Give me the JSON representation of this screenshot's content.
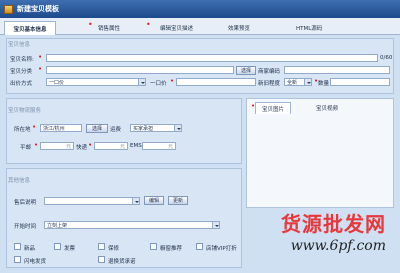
{
  "window": {
    "title": "新建宝贝模板"
  },
  "tabs": [
    {
      "label": "宝贝基本信息"
    },
    {
      "label": "销售属性"
    },
    {
      "label": "编辑宝贝描述"
    },
    {
      "label": "效果预览"
    },
    {
      "label": "HTML源码"
    }
  ],
  "basic": {
    "header": "宝贝信息",
    "name_label": "宝贝名称:",
    "name_counter": "0/60",
    "category_label": "宝贝分类",
    "category_button": "选择",
    "merchant_code_label": "商家编码",
    "sale_method_label": "出价方式",
    "sale_method_value": "一口价",
    "price_label": "一口价",
    "newness_label": "新旧程度",
    "newness_value": "全新",
    "quantity_label": "数量"
  },
  "logistics": {
    "header": "宝贝物流服务",
    "location_label": "所在地",
    "location_value": "浙江/杭州",
    "location_button": "选择",
    "freight_label": "运费",
    "freight_value": "买家承担",
    "mail_label": "平邮",
    "express_label": "快递",
    "ems_label": "EMS",
    "unit": "元"
  },
  "photo_panel": {
    "tabs": [
      {
        "label": "宝贝图片"
      },
      {
        "label": "宝贝视频"
      }
    ]
  },
  "other": {
    "header": "其他信息",
    "aftersale_label": "售后说明",
    "edit_button": "编辑",
    "update_button": "更新",
    "start_time_label": "开始时间",
    "start_time_value": "立刻上架",
    "checkboxes": [
      {
        "label": "新品"
      },
      {
        "label": "发票"
      },
      {
        "label": "保修"
      },
      {
        "label": "橱窗推荐"
      },
      {
        "label": "店铺VIP打折"
      },
      {
        "label": "闪电发货"
      },
      {
        "label": "退换货承诺"
      }
    ]
  },
  "watermark": {
    "text": "货源批发网",
    "url": "www.6pf.com"
  }
}
